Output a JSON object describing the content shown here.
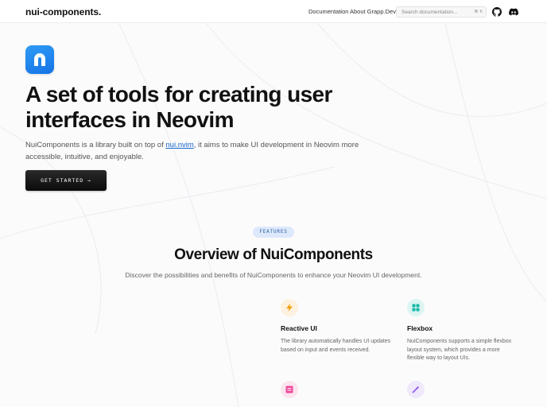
{
  "header": {
    "logo": "nui-components.",
    "nav": [
      {
        "label": "Documentation"
      },
      {
        "label": "About Grapp.Dev"
      }
    ],
    "search": {
      "placeholder": "Search documentation...",
      "shortcut": "⌘ K"
    },
    "icons": [
      "github-icon",
      "discord-icon"
    ]
  },
  "hero": {
    "logo_icon": "nui-logo-icon",
    "title": "A set of tools for creating user interfaces in Neovim",
    "desc_before": "NuiComponents is a library built on top of ",
    "desc_link": "nui.nvim",
    "desc_after": ", it aims to make UI development in Neovim more accessible, intuitive, and enjoyable.",
    "cta_label": "GET STARTED →"
  },
  "features": {
    "badge": "FEATURES",
    "title": "Overview of NuiComponents",
    "subtitle": "Discover the possibilities and benefits of NuiComponents to enhance your Neovim UI development.",
    "items": [
      {
        "icon": "lightning-icon",
        "color": "#f59e0b",
        "bg": "#fdf1df",
        "title": "Reactive UI",
        "desc": "The library automatically handles UI updates based on input and events received."
      },
      {
        "icon": "grid-icon",
        "color": "#14b8a6",
        "bg": "#dcf5f2",
        "title": "Flexbox",
        "desc": "NuiComponents supports a simple flexbox layout system, which provides a more flexible way to layout UIs."
      },
      {
        "icon": "form-icon",
        "color": "#ec4899",
        "bg": "#fce4ef",
        "title": "",
        "desc": ""
      },
      {
        "icon": "wand-icon",
        "color": "#8b5cf6",
        "bg": "#efe9fb",
        "title": "",
        "desc": ""
      }
    ]
  }
}
